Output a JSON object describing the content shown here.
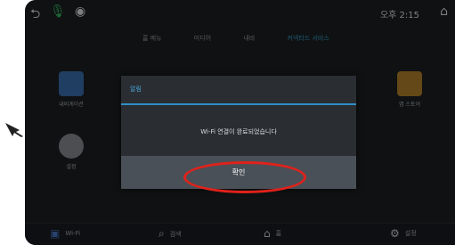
{
  "statusbar": {
    "back_icon": "back-arrow-icon",
    "mic_icon": "mic-icon",
    "nav_icon": "navigation-icon",
    "time": "오후 2:15",
    "home_icon": "home-icon"
  },
  "tabs": [
    {
      "label": "홈 메뉴"
    },
    {
      "label": "미디어"
    },
    {
      "label": "내비"
    },
    {
      "label": "커넥티드 서비스",
      "active": true
    }
  ],
  "apps": [
    {
      "label": "내비게이션",
      "icon": "navigation-app-icon"
    },
    {
      "label": "설정",
      "icon": "gear-icon"
    },
    {
      "label": "앱 스토어",
      "icon": "app-store-icon"
    }
  ],
  "dialog": {
    "title": "알림",
    "message": "Wi-Fi 연결이 완료되었습니다",
    "confirm_label": "확인"
  },
  "bottombar": {
    "left_label": "Wi-Fi",
    "search_label": "검색",
    "home_label": "홈",
    "settings_label": "설정"
  },
  "colors": {
    "accent": "#3aa3d6",
    "annotation": "#e0221b"
  }
}
